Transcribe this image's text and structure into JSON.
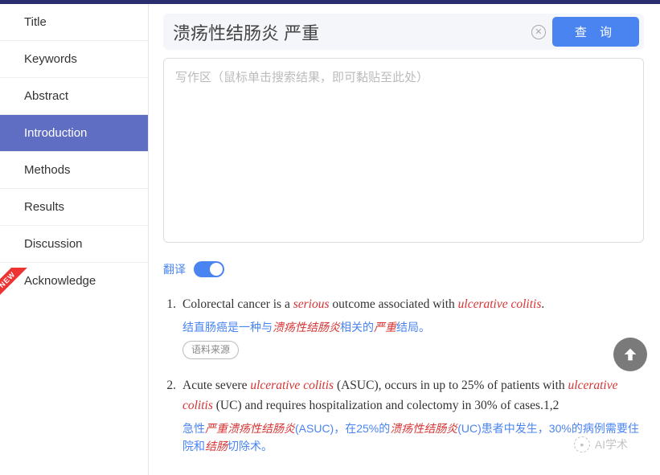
{
  "sidebar": {
    "items": [
      {
        "label": "Title",
        "active": false
      },
      {
        "label": "Keywords",
        "active": false
      },
      {
        "label": "Abstract",
        "active": false
      },
      {
        "label": "Introduction",
        "active": true
      },
      {
        "label": "Methods",
        "active": false
      },
      {
        "label": "Results",
        "active": false
      },
      {
        "label": "Discussion",
        "active": false
      },
      {
        "label": "Acknowledge",
        "active": false
      }
    ]
  },
  "search": {
    "value": "溃疡性结肠炎 严重",
    "button": "查 询"
  },
  "editor": {
    "placeholder": "写作区（鼠标单击搜索结果，即可黏贴至此处）"
  },
  "translate": {
    "label": "翻译",
    "on": true
  },
  "results": [
    {
      "num": "1.",
      "en_parts": [
        {
          "t": "Colorectal cancer is a ",
          "c": ""
        },
        {
          "t": "serious",
          "c": "hl-red-it"
        },
        {
          "t": " outcome associated with ",
          "c": ""
        },
        {
          "t": "ulcerative colitis",
          "c": "hl-red-it"
        },
        {
          "t": ".",
          "c": ""
        }
      ],
      "cn_parts": [
        {
          "t": "结直肠癌是一种与",
          "c": ""
        },
        {
          "t": "溃疡性结肠炎",
          "c": "hl-cn"
        },
        {
          "t": "相关的",
          "c": ""
        },
        {
          "t": "严重",
          "c": "hl-cn"
        },
        {
          "t": "结局。",
          "c": ""
        }
      ],
      "source_btn": "语料来源"
    },
    {
      "num": "2.",
      "en_parts": [
        {
          "t": "Acute severe ",
          "c": ""
        },
        {
          "t": "ulcerative colitis",
          "c": "hl-red-it"
        },
        {
          "t": " (ASUC), occurs in up to 25% of patients with ",
          "c": ""
        },
        {
          "t": "ulcerative colitis",
          "c": "hl-red-it"
        },
        {
          "t": " (UC) and requires hospitalization and colectomy in 30% of cases.1,2",
          "c": ""
        }
      ],
      "cn_parts": [
        {
          "t": "急性",
          "c": ""
        },
        {
          "t": "严重溃疡性结肠炎",
          "c": "hl-cn"
        },
        {
          "t": "(ASUC)，在25%的",
          "c": ""
        },
        {
          "t": "溃疡性结肠炎",
          "c": "hl-cn"
        },
        {
          "t": "(UC)患者中发生，30%的病例需要住院和",
          "c": ""
        },
        {
          "t": "结肠",
          "c": "hl-cn"
        },
        {
          "t": "切除术。",
          "c": ""
        }
      ]
    }
  ],
  "watermark": "AI学术"
}
